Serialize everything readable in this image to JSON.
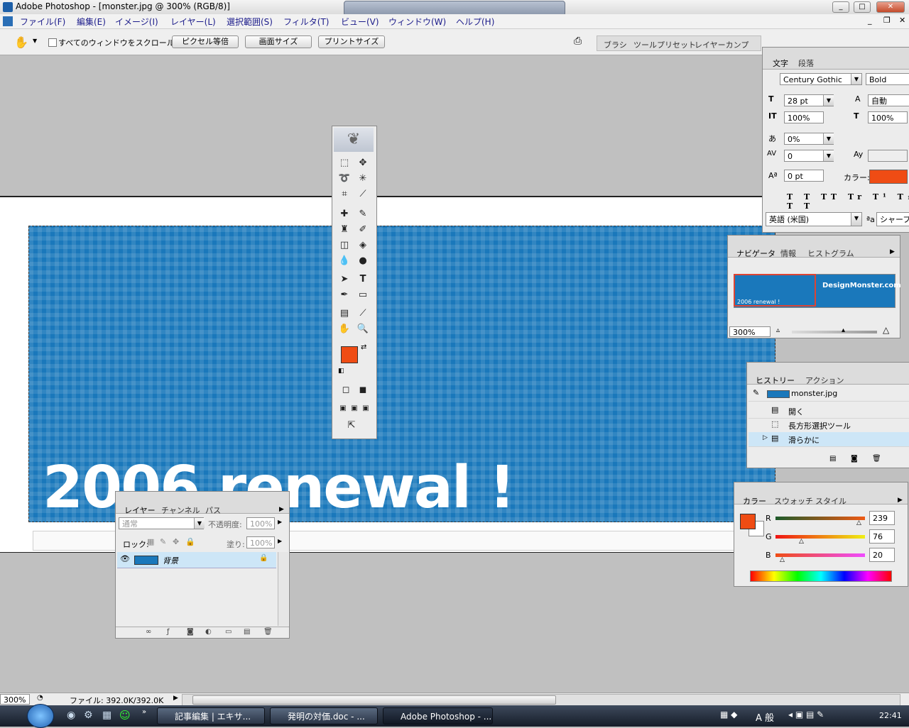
{
  "app": {
    "title": "Adobe Photoshop - [monster.jpg @ 300% (RGB/8)]"
  },
  "menu": {
    "file": "ファイル(F)",
    "edit": "編集(E)",
    "image": "イメージ(I)",
    "layer": "レイヤー(L)",
    "select": "選択範囲(S)",
    "filter": "フィルタ(T)",
    "view": "ビュー(V)",
    "window": "ウィンドウ(W)",
    "help": "ヘルプ(H)"
  },
  "options": {
    "scroll_all": "すべてのウィンドウをスクロール",
    "actual_pixels": "ピクセル等倍",
    "fit_screen": "画面サイズ",
    "print_size": "プリントサイズ"
  },
  "well_tabs": [
    "ブラシ",
    "ツールプリセット",
    "レイヤーカンプ"
  ],
  "canvas": {
    "headline": "2006 renewal !"
  },
  "character": {
    "tabs": [
      "文字",
      "段落"
    ],
    "font": "Century Gothic",
    "style": "Bold",
    "size": "28 pt",
    "leading": "自動",
    "vscale": "100%",
    "hscale": "100%",
    "tsume": "0%",
    "tracking": "0",
    "baseline": "0 pt",
    "color_label": "カラー:",
    "language": "英語 (米国)",
    "aa_prefix": "ªa",
    "aa": "シャープ",
    "color": "#ef4c14"
  },
  "navigator": {
    "tabs": [
      "ナビゲータ",
      "情報",
      "ヒストグラム"
    ],
    "zoom": "300%",
    "thumb_left": "2006 renewal !",
    "thumb_right": "DesignMonster.com"
  },
  "history": {
    "tabs": [
      "ヒストリー",
      "アクション"
    ],
    "snapshot": "monster.jpg",
    "items": [
      "開く",
      "長方形選択ツール",
      "滑らかに"
    ]
  },
  "color_panel": {
    "tabs": [
      "カラー",
      "スウォッチ",
      "スタイル"
    ],
    "r_label": "R",
    "g_label": "G",
    "b_label": "B",
    "r": 239,
    "g": 76,
    "b": 20,
    "foreground": "#ef4c14"
  },
  "layers": {
    "tabs": [
      "レイヤー",
      "チャンネル",
      "パス"
    ],
    "blend": "通常",
    "opacity_label": "不透明度:",
    "opacity": "100%",
    "lock_label": "ロック:",
    "fill_label": "塗り:",
    "fill": "100%",
    "layer_name": "背景"
  },
  "status": {
    "zoom": "300%",
    "file_info": "ファイル: 392.0K/392.0K"
  },
  "taskbar": {
    "task1": "記事編集 | エキサ...",
    "task2": "発明の対価.doc - ...",
    "task3": "Adobe Photoshop - ...",
    "ime": "A 般",
    "clock": "22:41"
  },
  "colors": {
    "accent": "#1a78bb",
    "fg_swatch": "#ef4c14"
  }
}
